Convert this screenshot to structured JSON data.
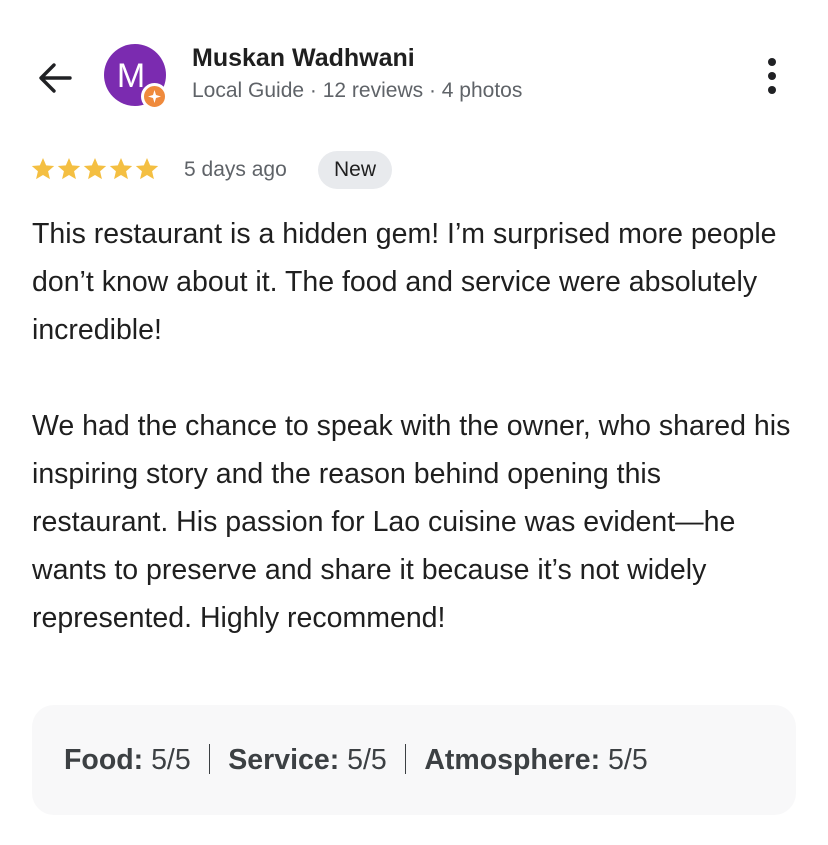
{
  "reviewer": {
    "name": "Muskan Wadhwani",
    "avatar_initial": "M",
    "avatar_color": "#7b2bb0",
    "badge_color": "#ef8a3c",
    "meta": "Local Guide · 12 reviews · 4 photos"
  },
  "icons": {
    "back": "back-arrow-icon",
    "more": "more-vert-icon",
    "star": "star-icon",
    "badge": "local-guide-badge-icon"
  },
  "rating": {
    "stars": 5,
    "max_stars": 5,
    "star_color": "#f4bf42",
    "time_ago": "5 days ago",
    "badge": "New"
  },
  "review": {
    "paragraphs": [
      "This restaurant is a hidden gem! I’m surprised more people don’t know about it. The food and service were absolutely incredible!",
      "We had the chance to speak with the owner, who shared his inspiring story and the reason behind opening this restaurant. His passion for Lao cuisine was evident—he wants to preserve and share it because it’s not widely represented. Highly recommend!"
    ]
  },
  "sub_ratings": [
    {
      "label": "Food:",
      "value": "5/5"
    },
    {
      "label": "Service:",
      "value": "5/5"
    },
    {
      "label": "Atmosphere:",
      "value": "5/5"
    }
  ]
}
